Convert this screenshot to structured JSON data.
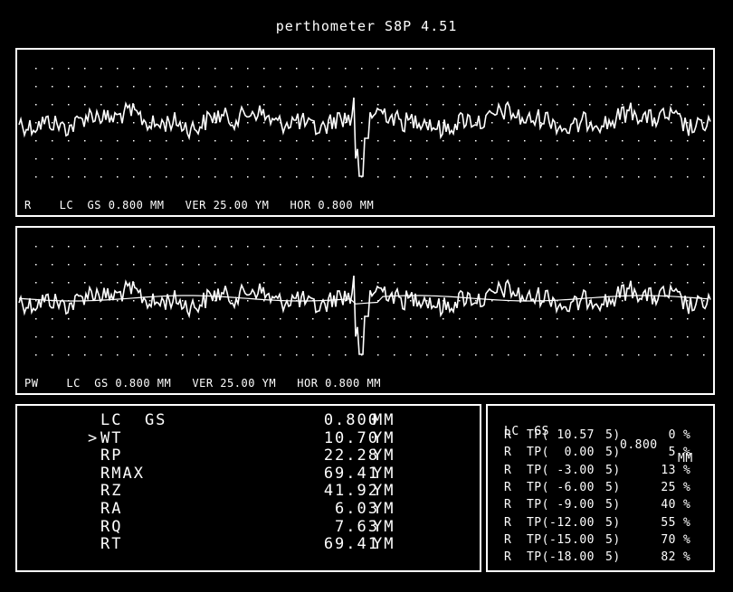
{
  "title": "perthometer S8P  4.51",
  "panels": [
    {
      "profile": "R",
      "caption": "R    LC  GS 0.800 MM   VER 25.00 YM   HOR 0.800 MM",
      "mean_line": false
    },
    {
      "profile": "PW",
      "caption": "PW    LC  GS 0.800 MM   VER 25.00 YM   HOR 0.800 MM",
      "mean_line": true
    }
  ],
  "params": [
    {
      "marker": "",
      "name": "LC  GS",
      "value": "0.800",
      "unit": "MM"
    },
    {
      "marker": ">",
      "name": "WT",
      "value": "10.70",
      "unit": "YM"
    },
    {
      "marker": "",
      "name": "RP",
      "value": "22.28",
      "unit": "YM"
    },
    {
      "marker": "",
      "name": "RMAX",
      "value": "69.41",
      "unit": "YM"
    },
    {
      "marker": "",
      "name": "RZ",
      "value": "41.92",
      "unit": "YM"
    },
    {
      "marker": "",
      "name": "RA",
      "value": "6.03",
      "unit": "YM"
    },
    {
      "marker": "",
      "name": "RQ",
      "value": "7.63",
      "unit": "YM"
    },
    {
      "marker": "",
      "name": "RT",
      "value": "69.41",
      "unit": "YM"
    }
  ],
  "tp_header": {
    "label": "LC  GS",
    "value": "0.800",
    "unit": "MM"
  },
  "tp_rows": [
    {
      "label": "R  TP(",
      "level": " 10.57",
      "tail": "5)",
      "pct": "0",
      "unit": "%"
    },
    {
      "label": "R  TP(",
      "level": "  0.00",
      "tail": "5)",
      "pct": "5",
      "unit": "%"
    },
    {
      "label": "R  TP(",
      "level": " -3.00",
      "tail": "5)",
      "pct": "13",
      "unit": "%"
    },
    {
      "label": "R  TP(",
      "level": " -6.00",
      "tail": "5)",
      "pct": "25",
      "unit": "%"
    },
    {
      "label": "R  TP(",
      "level": " -9.00",
      "tail": "5)",
      "pct": "40",
      "unit": "%"
    },
    {
      "label": "R  TP(",
      "level": "-12.00",
      "tail": "5)",
      "pct": "55",
      "unit": "%"
    },
    {
      "label": "R  TP(",
      "level": "-15.00",
      "tail": "5)",
      "pct": "70",
      "unit": "%"
    },
    {
      "label": "R  TP(",
      "level": "-18.00",
      "tail": "5)",
      "pct": "82",
      "unit": "%"
    }
  ]
}
